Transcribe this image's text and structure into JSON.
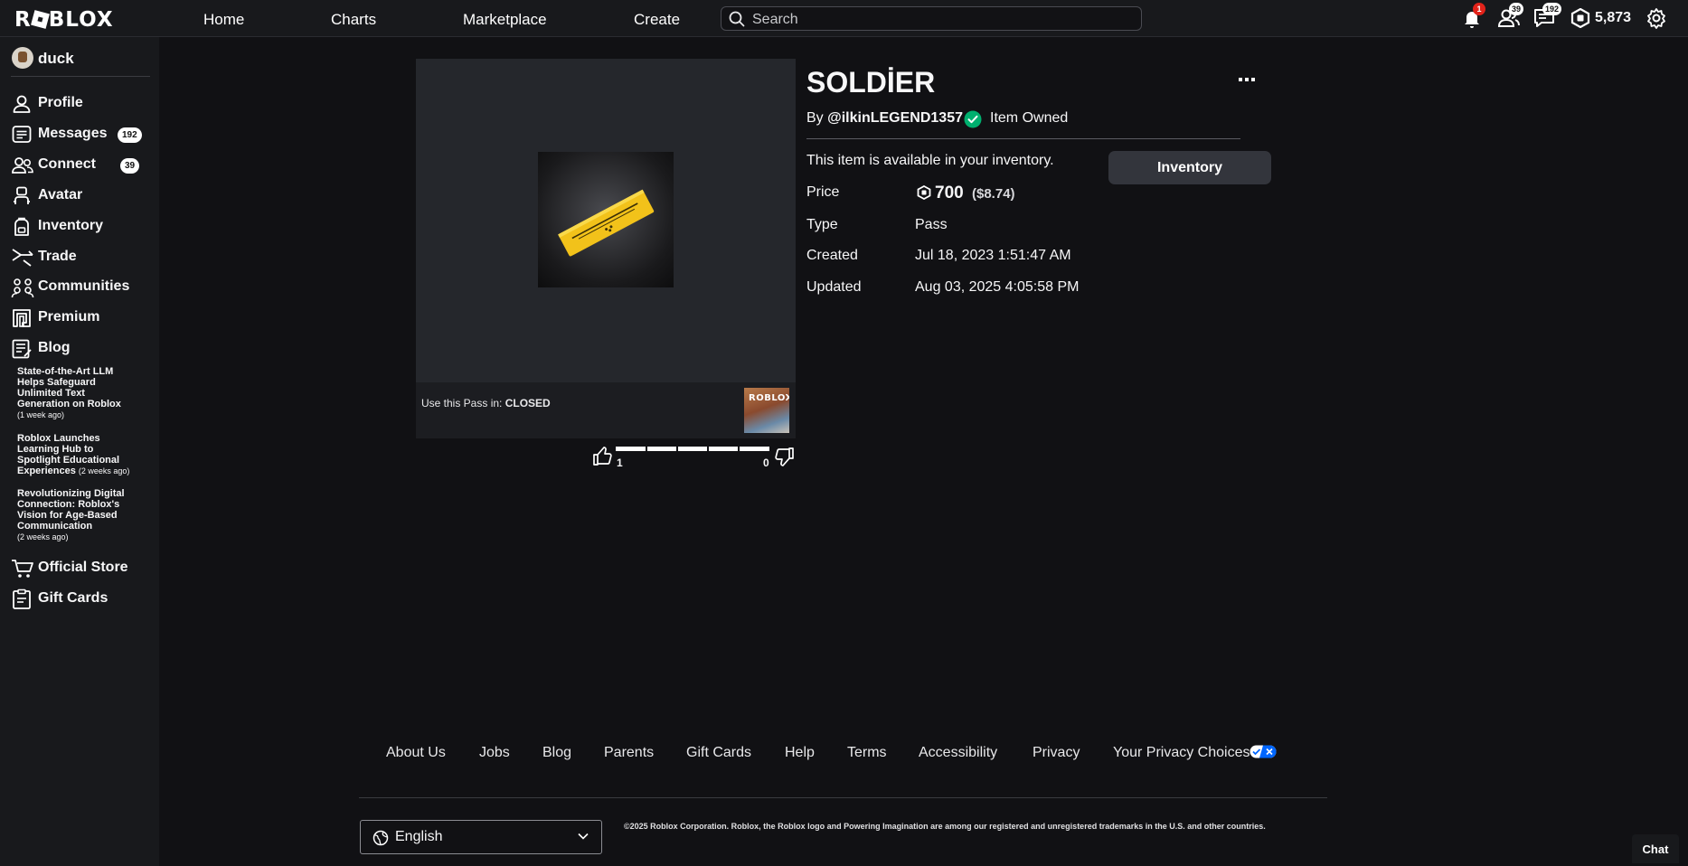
{
  "header": {
    "logo": "RO▣BLOX",
    "nav": [
      "Home",
      "Charts",
      "Marketplace",
      "Create"
    ],
    "search_placeholder": "Search",
    "notifications_badge": "1",
    "friends_badge": "39",
    "messages_badge": "192",
    "robux": "5,873"
  },
  "sidebar": {
    "username": "duck",
    "items": [
      {
        "label": "Profile",
        "icon": "user-icon"
      },
      {
        "label": "Messages",
        "icon": "message-icon",
        "badge": "192"
      },
      {
        "label": "Connect",
        "icon": "connect-icon",
        "badge": "39"
      },
      {
        "label": "Avatar",
        "icon": "avatar-icon"
      },
      {
        "label": "Inventory",
        "icon": "backpack-icon"
      },
      {
        "label": "Trade",
        "icon": "trade-icon"
      },
      {
        "label": "Communities",
        "icon": "communities-icon"
      },
      {
        "label": "Premium",
        "icon": "premium-icon"
      },
      {
        "label": "Blog",
        "icon": "blog-icon"
      }
    ],
    "blog_posts": [
      {
        "title": "State-of-the-Art LLM Helps Safeguard Unlimited Text Generation on Roblox",
        "ago": "(1 week ago)"
      },
      {
        "title": "Roblox Launches Learning Hub to Spotlight Educational Experiences",
        "ago": "(2 weeks ago)"
      },
      {
        "title": "Revolutionizing Digital Connection: Roblox's Vision for Age-Based Communication",
        "ago": "(2 weeks ago)"
      }
    ],
    "bottom_items": [
      {
        "label": "Official Store",
        "icon": "store-icon"
      },
      {
        "label": "Gift Cards",
        "icon": "gift-card-icon"
      }
    ]
  },
  "item": {
    "title": "SOLDİER",
    "by_prefix": "By ",
    "creator": "@ilkinLEGEND1357",
    "owned_label": "Item Owned",
    "availability": "This item is available in your inventory.",
    "inventory_button": "Inventory",
    "price_label": "Price",
    "price": "700",
    "price_usd": "($8.74)",
    "type_label": "Type",
    "type": "Pass",
    "created_label": "Created",
    "created": "Jul 18, 2023 1:51:47 AM",
    "updated_label": "Updated",
    "updated": "Aug 03, 2025 4:05:58 PM",
    "use_pass_prefix": "Use this Pass in: ",
    "use_pass_game": "CLOSED",
    "game_thumb_text": "ROBLOX",
    "upvotes": "1",
    "downvotes": "0"
  },
  "footer": {
    "links": [
      "About Us",
      "Jobs",
      "Blog",
      "Parents",
      "Gift Cards",
      "Help",
      "Terms",
      "Accessibility",
      "Privacy",
      "Your Privacy Choices"
    ],
    "language": "English",
    "copyright": "©2025 Roblox Corporation. Roblox, the Roblox logo and Powering Imagination are among our registered and unregistered trademarks in the U.S. and other countries."
  },
  "chat_button": "Chat",
  "colors": {
    "background": "#111114",
    "panel": "#18191c",
    "owned_green": "#00b06f",
    "badge_red": "#e2231a",
    "pass_gold": "#f2c21a"
  }
}
